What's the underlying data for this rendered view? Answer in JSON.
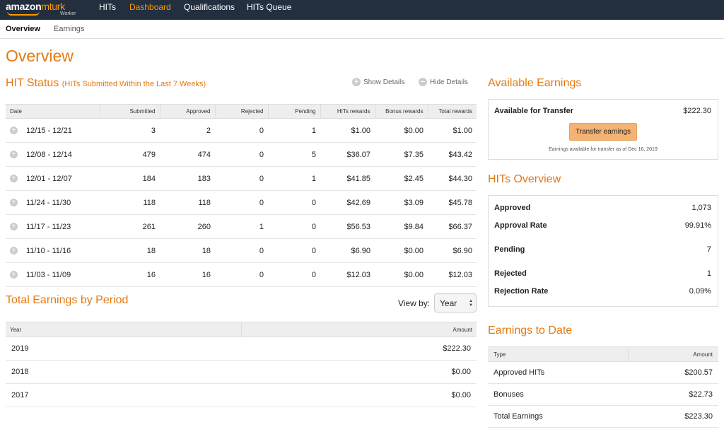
{
  "brand": {
    "line1_a": "amazon",
    "line1_b": "mturk",
    "line2": "Worker"
  },
  "topnav": [
    "HITs",
    "Dashboard",
    "Qualifications",
    "HITs Queue"
  ],
  "subnav": [
    "Overview",
    "Earnings"
  ],
  "page_title": "Overview",
  "hit_status": {
    "title": "HIT Status",
    "subtitle": "(HITs Submitted Within the Last 7 Weeks)",
    "show_details": "Show Details",
    "hide_details": "Hide Details",
    "columns": [
      "Date",
      "Submitted",
      "Approved",
      "Rejected",
      "Pending",
      "HITs rewards",
      "Bonus rewards",
      "Total rewards"
    ],
    "rows": [
      [
        "12/15 - 12/21",
        "3",
        "2",
        "0",
        "1",
        "$1.00",
        "$0.00",
        "$1.00"
      ],
      [
        "12/08 - 12/14",
        "479",
        "474",
        "0",
        "5",
        "$36.07",
        "$7.35",
        "$43.42"
      ],
      [
        "12/01 - 12/07",
        "184",
        "183",
        "0",
        "1",
        "$41.85",
        "$2.45",
        "$44.30"
      ],
      [
        "11/24 - 11/30",
        "118",
        "118",
        "0",
        "0",
        "$42.69",
        "$3.09",
        "$45.78"
      ],
      [
        "11/17 - 11/23",
        "261",
        "260",
        "1",
        "0",
        "$56.53",
        "$9.84",
        "$66.37"
      ],
      [
        "11/10 - 11/16",
        "18",
        "18",
        "0",
        "0",
        "$6.90",
        "$0.00",
        "$6.90"
      ],
      [
        "11/03 - 11/09",
        "16",
        "16",
        "0",
        "0",
        "$12.03",
        "$0.00",
        "$12.03"
      ]
    ]
  },
  "total_earnings": {
    "title": "Total Earnings by Period",
    "view_by_label": "View by:",
    "view_by_value": "Year",
    "columns": [
      "Year",
      "Amount"
    ],
    "rows": [
      [
        "2019",
        "$222.30"
      ],
      [
        "2018",
        "$0.00"
      ],
      [
        "2017",
        "$0.00"
      ]
    ]
  },
  "available": {
    "title": "Available Earnings",
    "label": "Available for Transfer",
    "value": "$222.30",
    "button": "Transfer earnings",
    "note": "Earnings available for transfer as of Dec 16, 2019"
  },
  "hits_overview": {
    "title": "HITs Overview",
    "rows": [
      [
        "Approved",
        "1,073"
      ],
      [
        "Approval Rate",
        "99.91%"
      ],
      [
        "Pending",
        "7"
      ],
      [
        "Rejected",
        "1"
      ],
      [
        "Rejection Rate",
        "0.09%"
      ]
    ]
  },
  "to_date": {
    "title": "Earnings to Date",
    "columns": [
      "Type",
      "Amount"
    ],
    "rows": [
      [
        "Approved HITs",
        "$200.57"
      ],
      [
        "Bonuses",
        "$22.73"
      ],
      [
        "Total Earnings",
        "$223.30"
      ]
    ]
  },
  "colors": {
    "accent": "#e47911",
    "nav_bg": "#232f3e",
    "nav_active": "#ff9900",
    "button": "#f4b273"
  },
  "icons": {
    "expand": "plus-circle-icon",
    "collapse": "minus-circle-icon",
    "select": "up-down-arrows-icon"
  }
}
